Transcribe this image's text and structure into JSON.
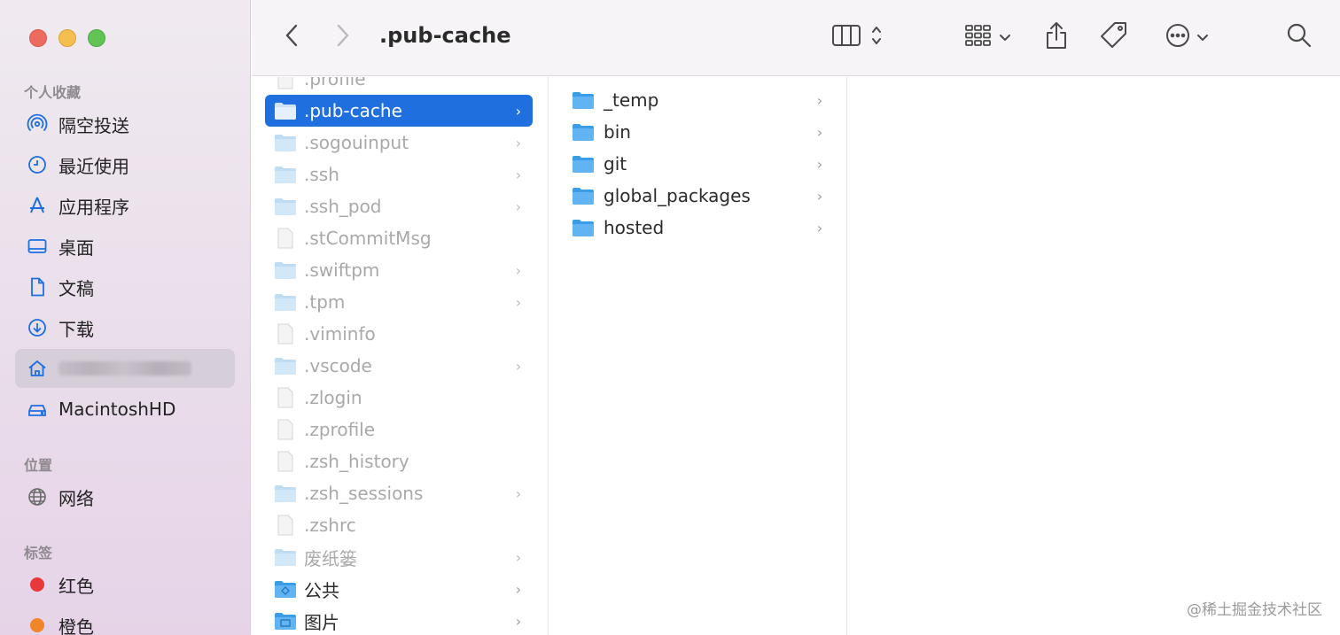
{
  "window": {
    "title": ".pub-cache"
  },
  "sidebar": {
    "sections": {
      "favorites": "个人收藏",
      "locations": "位置",
      "tags": "标签"
    },
    "favorites": [
      {
        "label": "隔空投送",
        "icon": "airdrop-icon"
      },
      {
        "label": "最近使用",
        "icon": "clock-icon"
      },
      {
        "label": "应用程序",
        "icon": "applications-icon"
      },
      {
        "label": "桌面",
        "icon": "desktop-icon"
      },
      {
        "label": "文稿",
        "icon": "document-icon"
      },
      {
        "label": "下载",
        "icon": "download-icon"
      },
      {
        "label": "",
        "icon": "home-icon"
      },
      {
        "label": "MacintoshHD",
        "icon": "drive-icon"
      }
    ],
    "locations": [
      {
        "label": "网络",
        "icon": "globe-icon"
      }
    ],
    "tags": [
      {
        "label": "红色",
        "color": "#e8393a"
      },
      {
        "label": "橙色",
        "color": "#f0862a"
      }
    ]
  },
  "toolbar": {
    "back": "back-icon",
    "forward": "forward-icon",
    "view": "column-view-icon",
    "group": "grid-group-icon",
    "share": "share-icon",
    "tag": "tag-icon",
    "more": "more-icon",
    "search": "search-icon"
  },
  "column1": [
    {
      "name": ".profile",
      "type": "file",
      "dim": true,
      "chevron": false
    },
    {
      "name": ".pub-cache",
      "type": "folder",
      "dim": false,
      "selected": true,
      "chevron": true
    },
    {
      "name": ".sogouinput",
      "type": "folder",
      "dim": true,
      "chevron": true
    },
    {
      "name": ".ssh",
      "type": "folder",
      "dim": true,
      "chevron": true
    },
    {
      "name": ".ssh_pod",
      "type": "folder",
      "dim": true,
      "chevron": true
    },
    {
      "name": ".stCommitMsg",
      "type": "file",
      "dim": true,
      "chevron": false
    },
    {
      "name": ".swiftpm",
      "type": "folder",
      "dim": true,
      "chevron": true
    },
    {
      "name": ".tpm",
      "type": "folder",
      "dim": true,
      "chevron": true
    },
    {
      "name": ".viminfo",
      "type": "file",
      "dim": true,
      "chevron": false
    },
    {
      "name": ".vscode",
      "type": "folder",
      "dim": true,
      "chevron": true
    },
    {
      "name": ".zlogin",
      "type": "file",
      "dim": true,
      "chevron": false
    },
    {
      "name": ".zprofile",
      "type": "file",
      "dim": true,
      "chevron": false
    },
    {
      "name": ".zsh_history",
      "type": "file",
      "dim": true,
      "chevron": false
    },
    {
      "name": ".zsh_sessions",
      "type": "folder",
      "dim": true,
      "chevron": true
    },
    {
      "name": ".zshrc",
      "type": "file",
      "dim": true,
      "chevron": false
    },
    {
      "name": "废纸篓",
      "type": "folder",
      "dim": true,
      "chevron": true
    },
    {
      "name": "公共",
      "type": "public-folder",
      "dim": false,
      "chevron": true
    },
    {
      "name": "图片",
      "type": "pictures-folder",
      "dim": false,
      "chevron": true
    }
  ],
  "column2": [
    {
      "name": "_temp",
      "chevron": true
    },
    {
      "name": "bin",
      "chevron": true
    },
    {
      "name": "git",
      "chevron": true
    },
    {
      "name": "global_packages",
      "chevron": true
    },
    {
      "name": "hosted",
      "chevron": true
    }
  ],
  "chevron_glyph": "›",
  "watermark": "@稀土掘金技术社区"
}
